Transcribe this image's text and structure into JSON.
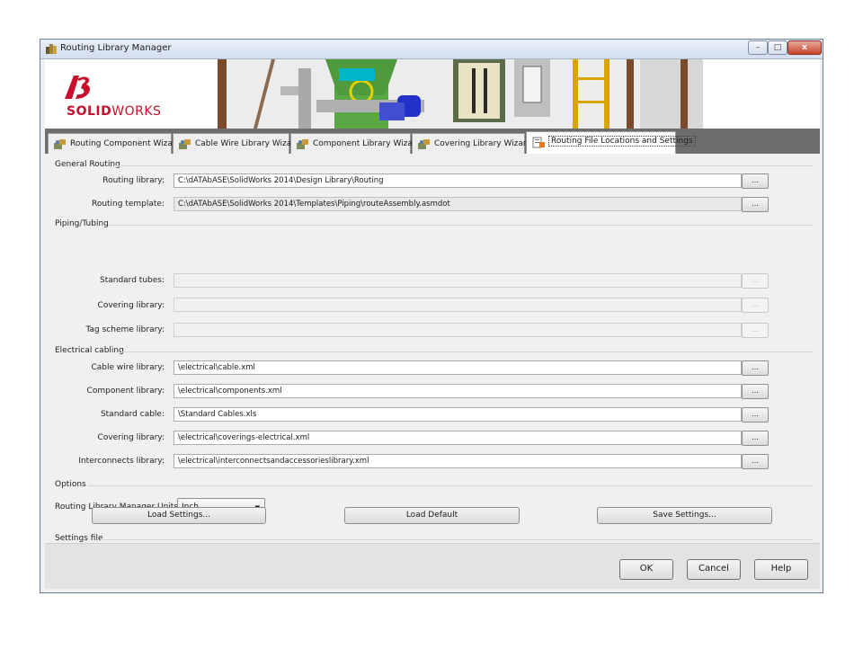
{
  "window": {
    "title": "Routing Library Manager",
    "controls": {
      "minimize": "–",
      "maximize": "□",
      "close": "x"
    }
  },
  "banner": {
    "logo_text_bold": "SOLID",
    "logo_text_light": "WORKS"
  },
  "tabs": [
    {
      "label": "Routing Component Wizard",
      "icon": "routing-component-icon",
      "active": false
    },
    {
      "label": "Cable Wire Library Wizard",
      "icon": "cable-wire-icon",
      "active": false
    },
    {
      "label": "Component Library Wizard",
      "icon": "component-library-icon",
      "active": false
    },
    {
      "label": "Covering Library Wizard",
      "icon": "covering-library-icon",
      "active": false
    },
    {
      "label": "Routing File Locations and Settings",
      "icon": "file-settings-icon",
      "active": true
    }
  ],
  "general": {
    "heading": "General Routing",
    "routing_library": {
      "label": "Routing library:",
      "value": "C:\\dATAbASE\\SolidWorks 2014\\Design Library\\Routing",
      "button": "..."
    },
    "routing_template": {
      "label": "Routing template:",
      "value": "C:\\dATAbASE\\SolidWorks 2014\\Templates\\Piping\\routeAssembly.asmdot",
      "button": "..."
    }
  },
  "piping": {
    "heading": "Piping/Tubing",
    "standard_tubes": {
      "label": "Standard tubes:",
      "value": "",
      "button": "..."
    },
    "covering_library": {
      "label": "Covering library:",
      "value": "",
      "button": "..."
    },
    "tag_scheme_library": {
      "label": "Tag scheme library:",
      "value": "",
      "button": "..."
    }
  },
  "electrical": {
    "heading": "Electrical cabling",
    "cable_wire_library": {
      "label": "Cable wire library:",
      "value": "\\electrical\\cable.xml",
      "button": "..."
    },
    "component_library": {
      "label": "Component library:",
      "value": "\\electrical\\components.xml",
      "button": "..."
    },
    "standard_cable": {
      "label": "Standard cable:",
      "value": "\\Standard Cables.xls",
      "button": "..."
    },
    "covering_library": {
      "label": "Covering library:",
      "value": "\\electrical\\coverings-electrical.xml",
      "button": "..."
    },
    "interconnects_library": {
      "label": "Interconnects library:",
      "value": "\\electrical\\interconnectsandaccessorieslibrary.xml",
      "button": "..."
    }
  },
  "options": {
    "heading": "Options",
    "units_label": "Routing Library Manager Units:",
    "units_value": "Inch"
  },
  "settings_file": {
    "heading": "Settings file",
    "load_settings": "Load Settings...",
    "load_default": "Load Default",
    "save_settings": "Save Settings..."
  },
  "footer": {
    "ok": "OK",
    "cancel": "Cancel",
    "help": "Help"
  },
  "colors": {
    "accent_red": "#c8102e",
    "tabbar_gray": "#6d6d6d",
    "window_bg": "#f0f0f0"
  }
}
